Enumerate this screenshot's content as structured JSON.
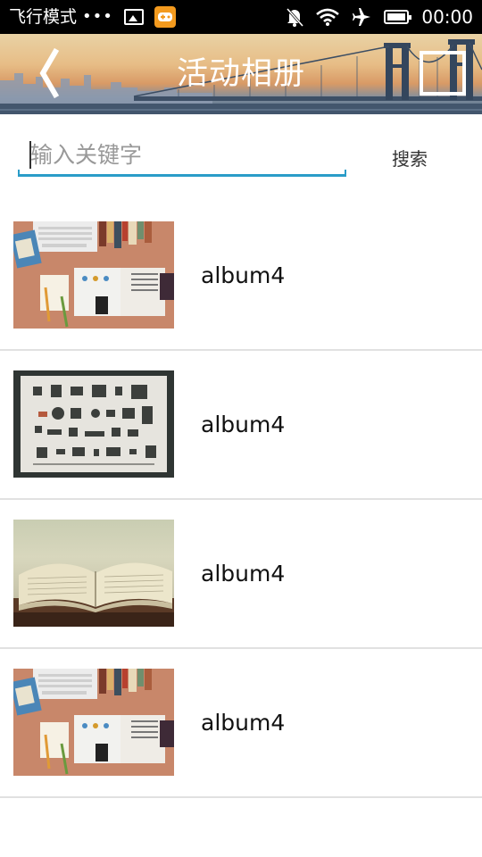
{
  "status_bar": {
    "mode_label": "飞行模式",
    "dots": "•••",
    "time": "00:00",
    "icons": [
      "image-icon",
      "game-icon",
      "mute-icon",
      "wifi-icon",
      "airplane-icon",
      "battery-icon"
    ]
  },
  "header": {
    "title": "活动相册",
    "back_icon": "back-chevron-icon",
    "right_icon": "frame-icon"
  },
  "search": {
    "placeholder": "输入关键字",
    "value": "",
    "button_label": "搜索"
  },
  "albums": [
    {
      "name": "album4",
      "thumbnail": "workspace-desk-photo"
    },
    {
      "name": "album4",
      "thumbnail": "camera-parts-flatlay-photo"
    },
    {
      "name": "album4",
      "thumbnail": "open-book-photo"
    },
    {
      "name": "album4",
      "thumbnail": "workspace-desk-photo"
    }
  ],
  "colors": {
    "status_bar": "#000000",
    "search_underline": "#2a9cc8",
    "divider": "#e1e1e1",
    "banner_sky": "#e7bd86"
  }
}
